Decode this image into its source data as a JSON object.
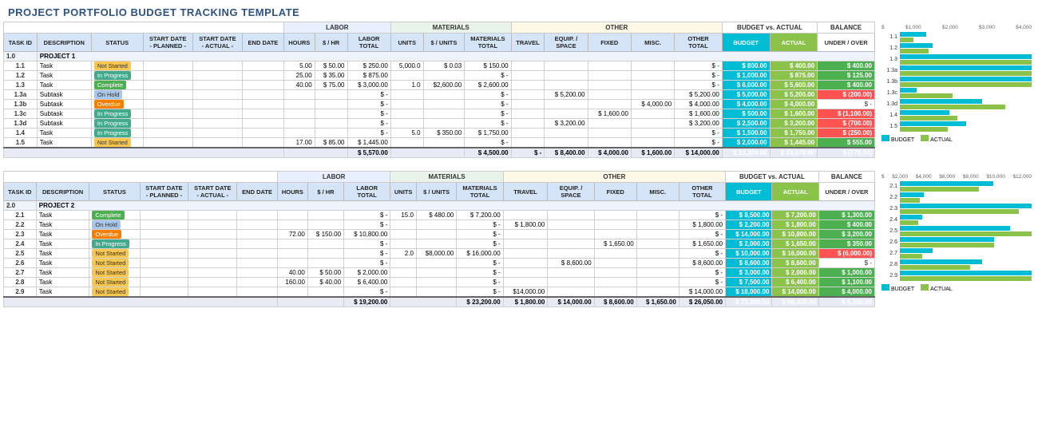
{
  "title": "PROJECT PORTFOLIO BUDGET TRACKING TEMPLATE",
  "colors": {
    "budget": "#00bcd4",
    "actual": "#8bc34a",
    "balance_pos": "#4CAF50",
    "balance_neg": "#ff5252"
  },
  "project1": {
    "name": "PROJECT 1",
    "id": "1.0",
    "columns": {
      "group_headers": [
        "LABOR",
        "MATERIALS",
        "OTHER",
        "BUDGET vs. ACTUAL",
        "BALANCE"
      ],
      "col_headers": [
        "TASK ID",
        "DESCRIPTION",
        "STATUS",
        "START DATE PLANNED",
        "START DATE ACTUAL",
        "END DATE",
        "HOURS",
        "$ / HR",
        "LABOR TOTAL",
        "UNITS",
        "$ / UNITS",
        "MATERIALS TOTAL",
        "TRAVEL",
        "EQUIP. / SPACE",
        "FIXED",
        "MISC.",
        "OTHER TOTAL",
        "BUDGET",
        "ACTUAL",
        "UNDER / OVER"
      ]
    },
    "tasks": [
      {
        "id": "1.1",
        "desc": "Task",
        "status": "Not Started",
        "hours": "5.00",
        "rate": "$ 50.00",
        "labor": "$ 250.00",
        "units": "5,000.0",
        "unit_cost": "$ 0.03",
        "mat_total": "$ 150.00",
        "travel": "",
        "equip": "",
        "fixed": "",
        "misc": "",
        "other_total": "$ -",
        "budget": "$ 800.00",
        "actual": "$ 400.00",
        "balance": "$ 400.00",
        "bal_type": "pos"
      },
      {
        "id": "1.2",
        "desc": "Task",
        "status": "In Progress",
        "hours": "25.00",
        "rate": "$ 35.00",
        "labor": "$ 875.00",
        "units": "",
        "unit_cost": "",
        "mat_total": "$ -",
        "travel": "",
        "equip": "",
        "fixed": "",
        "misc": "",
        "other_total": "$ -",
        "budget": "$ 1,000.00",
        "actual": "$ 875.00",
        "balance": "$ 125.00",
        "bal_type": "pos"
      },
      {
        "id": "1.3",
        "desc": "Task",
        "status": "Complete",
        "hours": "40.00",
        "rate": "$ 75.00",
        "labor": "$ 3,000.00",
        "units": "1.0",
        "unit_cost": "$2,600.00",
        "mat_total": "$ 2,600.00",
        "travel": "",
        "equip": "",
        "fixed": "",
        "misc": "",
        "other_total": "$ -",
        "budget": "$ 6,000.00",
        "actual": "$ 5,600.00",
        "balance": "$ 400.00",
        "bal_type": "pos"
      },
      {
        "id": "1.3a",
        "desc": "Subtask",
        "status": "On Hold",
        "hours": "",
        "rate": "",
        "labor": "$ -",
        "units": "",
        "unit_cost": "",
        "mat_total": "$ -",
        "travel": "",
        "equip": "$ 5,200.00",
        "fixed": "",
        "misc": "",
        "other_total": "$ 5,200.00",
        "budget": "$ 5,000.00",
        "actual": "$ 5,200.00",
        "balance": "$ (200.00)",
        "bal_type": "neg"
      },
      {
        "id": "1.3b",
        "desc": "Subtask",
        "status": "Overdue",
        "hours": "",
        "rate": "",
        "labor": "$ -",
        "units": "",
        "unit_cost": "",
        "mat_total": "$ -",
        "travel": "",
        "equip": "",
        "fixed": "",
        "misc": "$ 4,000.00",
        "other_total": "$ 4,000.00",
        "budget": "$ 4,000.00",
        "actual": "$ 4,000.00",
        "balance": "$ -",
        "bal_type": "zero"
      },
      {
        "id": "1.3c",
        "desc": "Subtask",
        "status": "In Progress",
        "hours": "",
        "rate": "",
        "labor": "$ -",
        "units": "",
        "unit_cost": "",
        "mat_total": "$ -",
        "travel": "",
        "equip": "",
        "fixed": "$ 1,600.00",
        "misc": "",
        "other_total": "$ 1,600.00",
        "budget": "$ 500.00",
        "actual": "$ 1,600.00",
        "balance": "$ (1,100.00)",
        "bal_type": "neg"
      },
      {
        "id": "1.3d",
        "desc": "Subtask",
        "status": "In Progress",
        "hours": "",
        "rate": "",
        "labor": "$ -",
        "units": "",
        "unit_cost": "",
        "mat_total": "$ -",
        "travel": "",
        "equip": "$ 3,200.00",
        "fixed": "",
        "misc": "",
        "other_total": "$ 3,200.00",
        "budget": "$ 2,500.00",
        "actual": "$ 3,200.00",
        "balance": "$ (700.00)",
        "bal_type": "neg"
      },
      {
        "id": "1.4",
        "desc": "Task",
        "status": "In Progress",
        "hours": "",
        "rate": "",
        "labor": "$ -",
        "units": "5.0",
        "unit_cost": "$ 350.00",
        "mat_total": "$ 1,750.00",
        "travel": "",
        "equip": "",
        "fixed": "",
        "misc": "",
        "other_total": "$ -",
        "budget": "$ 1,500.00",
        "actual": "$ 1,750.00",
        "balance": "$ (250.00)",
        "bal_type": "neg"
      },
      {
        "id": "1.5",
        "desc": "Task",
        "status": "Not Started",
        "hours": "17.00",
        "rate": "$ 85.00",
        "labor": "$ 1,445.00",
        "units": "",
        "unit_cost": "",
        "mat_total": "$ -",
        "travel": "",
        "equip": "",
        "fixed": "",
        "misc": "",
        "other_total": "$ -",
        "budget": "$ 2,000.00",
        "actual": "$ 1,445.00",
        "balance": "$ 555.00",
        "bal_type": "pos"
      }
    ],
    "totals": {
      "labor": "$ 5,570.00",
      "mat_total": "$ 4,500.00",
      "travel": "$ -",
      "equip": "$ 8,400.00",
      "fixed": "$ 4,000.00",
      "misc": "$ 1,600.00",
      "other_total": "$ 14,000.00",
      "budget": "$ 23,300.00",
      "actual": "$ 24,070.00",
      "balance": "$ (770.00)",
      "bal_type": "neg"
    },
    "chart": {
      "scale": [
        "$",
        "$1,000",
        "$2,000",
        "$3,000",
        "$4,000"
      ],
      "max": 4000,
      "rows": [
        {
          "label": "1.1",
          "budget": 800,
          "actual": 400
        },
        {
          "label": "1.2",
          "budget": 1000,
          "actual": 875
        },
        {
          "label": "1.3",
          "budget": 6000,
          "actual": 5600
        },
        {
          "label": "1.3a",
          "budget": 5000,
          "actual": 5200
        },
        {
          "label": "1.3b",
          "budget": 4000,
          "actual": 4000
        },
        {
          "label": "1.3c",
          "budget": 500,
          "actual": 1600
        },
        {
          "label": "1.3d",
          "budget": 2500,
          "actual": 3200
        },
        {
          "label": "1.4",
          "budget": 1500,
          "actual": 1750
        },
        {
          "label": "1.5",
          "budget": 2000,
          "actual": 1445
        }
      ]
    }
  },
  "project2": {
    "name": "PROJECT 2",
    "id": "2.0",
    "tasks": [
      {
        "id": "2.1",
        "desc": "Task",
        "status": "Complete",
        "hours": "",
        "rate": "",
        "labor": "$ -",
        "units": "15.0",
        "unit_cost": "$ 480.00",
        "mat_total": "$ 7,200.00",
        "travel": "",
        "equip": "",
        "fixed": "",
        "misc": "",
        "other_total": "$ -",
        "budget": "$ 8,500.00",
        "actual": "$ 7,200.00",
        "balance": "$ 1,300.00",
        "bal_type": "pos"
      },
      {
        "id": "2.2",
        "desc": "Task",
        "status": "On Hold",
        "hours": "",
        "rate": "",
        "labor": "$ -",
        "units": "",
        "unit_cost": "",
        "mat_total": "$ -",
        "travel": "$ 1,800.00",
        "equip": "",
        "fixed": "",
        "misc": "",
        "other_total": "$ 1,800.00",
        "budget": "$ 2,200.00",
        "actual": "$ 1,800.00",
        "balance": "$ 400.00",
        "bal_type": "pos"
      },
      {
        "id": "2.3",
        "desc": "Task",
        "status": "Overdue",
        "hours": "72.00",
        "rate": "$ 150.00",
        "labor": "$ 10,800.00",
        "units": "",
        "unit_cost": "",
        "mat_total": "$ -",
        "travel": "",
        "equip": "",
        "fixed": "",
        "misc": "",
        "other_total": "$ -",
        "budget": "$ 14,000.00",
        "actual": "$ 10,800.00",
        "balance": "$ 3,200.00",
        "bal_type": "pos"
      },
      {
        "id": "2.4",
        "desc": "Task",
        "status": "In Progress",
        "hours": "",
        "rate": "",
        "labor": "$ -",
        "units": "",
        "unit_cost": "",
        "mat_total": "$ -",
        "travel": "",
        "equip": "",
        "fixed": "$ 1,650.00",
        "misc": "",
        "other_total": "$ 1,650.00",
        "budget": "$ 2,000.00",
        "actual": "$ 1,650.00",
        "balance": "$ 350.00",
        "bal_type": "pos"
      },
      {
        "id": "2.5",
        "desc": "Task",
        "status": "Not Started",
        "hours": "",
        "rate": "",
        "labor": "$ -",
        "units": "2.0",
        "unit_cost": "$8,000.00",
        "mat_total": "$ 16,000.00",
        "travel": "",
        "equip": "",
        "fixed": "",
        "misc": "",
        "other_total": "$ -",
        "budget": "$ 10,000.00",
        "actual": "$ 16,000.00",
        "balance": "$ (6,000.00)",
        "bal_type": "neg"
      },
      {
        "id": "2.6",
        "desc": "Task",
        "status": "Not Started",
        "hours": "",
        "rate": "",
        "labor": "$ -",
        "units": "",
        "unit_cost": "",
        "mat_total": "$ -",
        "travel": "",
        "equip": "$ 8,600.00",
        "fixed": "",
        "misc": "",
        "other_total": "$ 8,600.00",
        "budget": "$ 8,600.00",
        "actual": "$ 8,600.00",
        "balance": "$ -",
        "bal_type": "zero"
      },
      {
        "id": "2.7",
        "desc": "Task",
        "status": "Not Started",
        "hours": "40.00",
        "rate": "$ 50.00",
        "labor": "$ 2,000.00",
        "units": "",
        "unit_cost": "",
        "mat_total": "$ -",
        "travel": "",
        "equip": "",
        "fixed": "",
        "misc": "",
        "other_total": "$ -",
        "budget": "$ 3,000.00",
        "actual": "$ 2,000.00",
        "balance": "$ 1,000.00",
        "bal_type": "pos"
      },
      {
        "id": "2.8",
        "desc": "Task",
        "status": "Not Started",
        "hours": "160.00",
        "rate": "$ 40.00",
        "labor": "$ 6,400.00",
        "units": "",
        "unit_cost": "",
        "mat_total": "$ -",
        "travel": "",
        "equip": "",
        "fixed": "",
        "misc": "",
        "other_total": "$ -",
        "budget": "$ 7,500.00",
        "actual": "$ 6,400.00",
        "balance": "$ 1,100.00",
        "bal_type": "pos"
      },
      {
        "id": "2.9",
        "desc": "Task",
        "status": "Not Started",
        "hours": "",
        "rate": "",
        "labor": "$ -",
        "units": "",
        "unit_cost": "",
        "mat_total": "$ -",
        "travel": "$14,000.00",
        "equip": "",
        "fixed": "",
        "misc": "",
        "other_total": "$ 14,000.00",
        "budget": "$ 18,000.00",
        "actual": "$ 14,000.00",
        "balance": "$ 4,000.00",
        "bal_type": "pos"
      }
    ],
    "totals": {
      "labor": "$ 19,200.00",
      "mat_total": "$ 23,200.00",
      "travel": "$ 1,800.00",
      "equip": "$ 14,000.00",
      "fixed": "$ 8,600.00",
      "misc": "$ 1,650.00",
      "other_total": "$ 26,050.00",
      "budget": "$ 73,800.00",
      "actual": "$ 68,450.00",
      "balance": "$ 5,350.00",
      "bal_type": "pos"
    },
    "chart": {
      "scale": [
        "$",
        "$2,000",
        "$4,000",
        "$6,000",
        "$8,000",
        "$10,000",
        "$12,000"
      ],
      "max": 12000,
      "rows": [
        {
          "label": "2.1",
          "budget": 8500,
          "actual": 7200
        },
        {
          "label": "2.2",
          "budget": 2200,
          "actual": 1800
        },
        {
          "label": "2.3",
          "budget": 14000,
          "actual": 10800
        },
        {
          "label": "2.4",
          "budget": 2000,
          "actual": 1650
        },
        {
          "label": "2.5",
          "budget": 10000,
          "actual": 16000
        },
        {
          "label": "2.6",
          "budget": 8600,
          "actual": 8600
        },
        {
          "label": "2.7",
          "budget": 3000,
          "actual": 2000
        },
        {
          "label": "2.8",
          "budget": 7500,
          "actual": 6400
        },
        {
          "label": "2.9",
          "budget": 18000,
          "actual": 14000
        }
      ]
    }
  },
  "labels": {
    "budget": "BUDGET",
    "actual": "ACTUAL",
    "under_over": "UNDER / OVER",
    "budget_vs_actual": "BUDGET vs. ACTUAL",
    "balance": "BALANCE",
    "labor": "LABOR",
    "materials": "MATERIALS",
    "other": "OTHER",
    "legend_budget": "BUDGET",
    "legend_actual": "ACTUAL"
  }
}
